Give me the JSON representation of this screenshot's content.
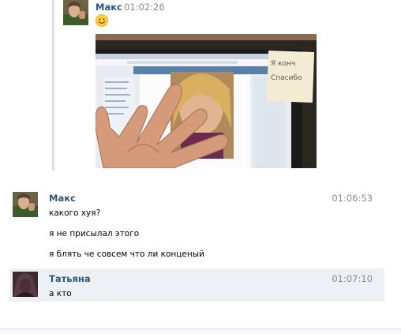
{
  "forwarded": {
    "author": "Макс",
    "time": "01:02:26",
    "emoji": "smile-emoji",
    "photo_sticker_text": "Я конч\nСпасибо"
  },
  "messages": [
    {
      "author": "Макс",
      "time": "01:06:53",
      "lines": [
        "какого хуя?",
        "я не присылал этого",
        "я блять че совсем что ли конценый"
      ]
    },
    {
      "author": "Татьяна",
      "time": "01:07:10",
      "lines": [
        "а кто"
      ],
      "highlighted": true
    }
  ],
  "colors": {
    "name": "#2b587a",
    "time": "#8a8a8a",
    "unread_bg": "#edf1f5",
    "quote_bar": "#d6dfea"
  }
}
